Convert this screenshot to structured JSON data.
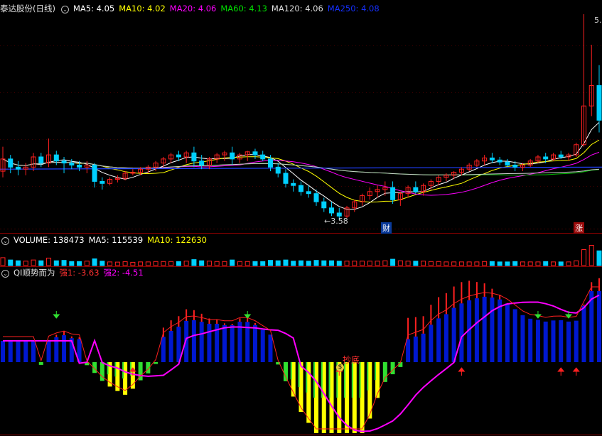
{
  "stock": {
    "name": "泰达股份",
    "period": "(日线)"
  },
  "price_header": {
    "items": [
      {
        "label": "MA5: 4.05",
        "color": "#ffffff"
      },
      {
        "label": "MA10: 4.02",
        "color": "#ffff00"
      },
      {
        "label": "MA20: 4.06",
        "color": "#ff00ff"
      },
      {
        "label": "MA60: 4.13",
        "color": "#00e000"
      },
      {
        "label": "MA120: 4.06",
        "color": "#dddddd"
      },
      {
        "label": "MA250: 4.08",
        "color": "#1530ff"
      }
    ]
  },
  "volume_header": {
    "items": [
      {
        "label": "VOLUME: 138473",
        "color": "#ffffff"
      },
      {
        "label": "MA5: 115539",
        "color": "#ffffff"
      },
      {
        "label": "MA10: 122630",
        "color": "#ffff00"
      }
    ]
  },
  "indicator_header": {
    "name": "QI顺势而为",
    "items": [
      {
        "label": "强1: -3.63",
        "color": "#ff3030"
      },
      {
        "label": "强2: -4.51",
        "color": "#ff00ff"
      }
    ]
  },
  "annotations": {
    "low_price": "3.58",
    "high_price": "5.",
    "finance_badge": "财",
    "limit_up_badge": "涨",
    "bottom_label": "抄底",
    "bottom_icon": "$"
  },
  "colors": {
    "up": "#ff2020",
    "down": "#00d0ff",
    "grid": "#800000",
    "bg": "#000000"
  },
  "chart_data": [
    {
      "type": "candlestick",
      "title": "泰达股份 (日线)",
      "y_low": 3.58,
      "y_high_label": "5.",
      "ohlc": [
        [
          4.06,
          4.3,
          4.0,
          4.18
        ],
        [
          4.18,
          4.22,
          4.04,
          4.1
        ],
        [
          4.1,
          4.16,
          4.02,
          4.08
        ],
        [
          4.08,
          4.14,
          4.02,
          4.1
        ],
        [
          4.1,
          4.24,
          4.06,
          4.2
        ],
        [
          4.2,
          4.24,
          4.1,
          4.14
        ],
        [
          4.14,
          4.38,
          4.1,
          4.22
        ],
        [
          4.22,
          4.26,
          4.12,
          4.16
        ],
        [
          4.16,
          4.2,
          4.04,
          4.14
        ],
        [
          4.14,
          4.18,
          4.08,
          4.12
        ],
        [
          4.12,
          4.16,
          4.06,
          4.1
        ],
        [
          4.1,
          4.16,
          4.04,
          4.12
        ],
        [
          4.12,
          4.14,
          3.9,
          3.96
        ],
        [
          3.96,
          4.0,
          3.88,
          3.94
        ],
        [
          3.94,
          4.0,
          3.92,
          3.98
        ],
        [
          3.98,
          4.02,
          3.95,
          3.99
        ],
        [
          3.99,
          4.06,
          3.97,
          4.04
        ],
        [
          4.04,
          4.08,
          4.02,
          4.05
        ],
        [
          4.05,
          4.1,
          4.02,
          4.08
        ],
        [
          4.08,
          4.12,
          4.04,
          4.1
        ],
        [
          4.1,
          4.16,
          4.06,
          4.14
        ],
        [
          4.14,
          4.2,
          4.1,
          4.18
        ],
        [
          4.18,
          4.24,
          4.14,
          4.22
        ],
        [
          4.22,
          4.26,
          4.16,
          4.2
        ],
        [
          4.2,
          4.26,
          4.14,
          4.24
        ],
        [
          4.24,
          4.3,
          4.1,
          4.16
        ],
        [
          4.16,
          4.22,
          4.08,
          4.12
        ],
        [
          4.12,
          4.2,
          4.08,
          4.18
        ],
        [
          4.18,
          4.24,
          4.14,
          4.22
        ],
        [
          4.22,
          4.26,
          4.16,
          4.24
        ],
        [
          4.24,
          4.3,
          4.12,
          4.18
        ],
        [
          4.18,
          4.24,
          4.14,
          4.22
        ],
        [
          4.22,
          4.26,
          4.16,
          4.25
        ],
        [
          4.25,
          4.28,
          4.18,
          4.22
        ],
        [
          4.22,
          4.26,
          4.16,
          4.18
        ],
        [
          4.18,
          4.22,
          4.06,
          4.1
        ],
        [
          4.1,
          4.14,
          4.0,
          4.04
        ],
        [
          4.04,
          4.08,
          3.9,
          3.94
        ],
        [
          3.94,
          3.98,
          3.86,
          3.92
        ],
        [
          3.92,
          3.96,
          3.82,
          3.86
        ],
        [
          3.86,
          3.92,
          3.8,
          3.84
        ],
        [
          3.84,
          3.88,
          3.72,
          3.76
        ],
        [
          3.76,
          3.8,
          3.66,
          3.7
        ],
        [
          3.7,
          3.76,
          3.62,
          3.65
        ],
        [
          3.65,
          3.7,
          3.58,
          3.62
        ],
        [
          3.62,
          3.72,
          3.6,
          3.7
        ],
        [
          3.7,
          3.78,
          3.66,
          3.76
        ],
        [
          3.76,
          3.84,
          3.72,
          3.82
        ],
        [
          3.82,
          3.9,
          3.78,
          3.86
        ],
        [
          3.86,
          3.92,
          3.8,
          3.88
        ],
        [
          3.88,
          3.96,
          3.82,
          3.9
        ],
        [
          3.9,
          3.96,
          3.74,
          3.78
        ],
        [
          3.78,
          3.86,
          3.72,
          3.84
        ],
        [
          3.84,
          3.92,
          3.8,
          3.9
        ],
        [
          3.9,
          3.96,
          3.84,
          3.86
        ],
        [
          3.86,
          3.94,
          3.82,
          3.92
        ],
        [
          3.92,
          3.98,
          3.88,
          3.96
        ],
        [
          3.96,
          4.02,
          3.92,
          4.0
        ],
        [
          4.0,
          4.04,
          3.96,
          4.02
        ],
        [
          4.02,
          4.06,
          3.98,
          4.05
        ],
        [
          4.05,
          4.1,
          4.02,
          4.08
        ],
        [
          4.08,
          4.14,
          4.06,
          4.12
        ],
        [
          4.12,
          4.18,
          4.1,
          4.16
        ],
        [
          4.16,
          4.22,
          4.12,
          4.19
        ],
        [
          4.19,
          4.24,
          4.14,
          4.17
        ],
        [
          4.17,
          4.2,
          4.12,
          4.15
        ],
        [
          4.15,
          4.18,
          4.1,
          4.12
        ],
        [
          4.12,
          4.16,
          4.06,
          4.1
        ],
        [
          4.1,
          4.14,
          4.06,
          4.12
        ],
        [
          4.12,
          4.18,
          4.1,
          4.16
        ],
        [
          4.16,
          4.22,
          4.14,
          4.2
        ],
        [
          4.2,
          4.24,
          4.14,
          4.18
        ],
        [
          4.18,
          4.24,
          4.16,
          4.22
        ],
        [
          4.22,
          4.26,
          4.18,
          4.2
        ],
        [
          4.2,
          4.24,
          4.16,
          4.22
        ],
        [
          4.22,
          4.34,
          4.2,
          4.32
        ],
        [
          4.32,
          5.6,
          4.3,
          4.7
        ],
        [
          4.7,
          5.3,
          4.6,
          4.9
        ],
        [
          4.9,
          5.1,
          4.44,
          4.56
        ]
      ]
    },
    {
      "type": "bar",
      "title": "VOLUME",
      "values": [
        138473
      ]
    },
    {
      "type": "bar",
      "title": "QI顺势而为",
      "series": [
        {
          "name": "强1",
          "last": -3.63
        },
        {
          "name": "强2",
          "last": -4.51
        }
      ]
    }
  ]
}
